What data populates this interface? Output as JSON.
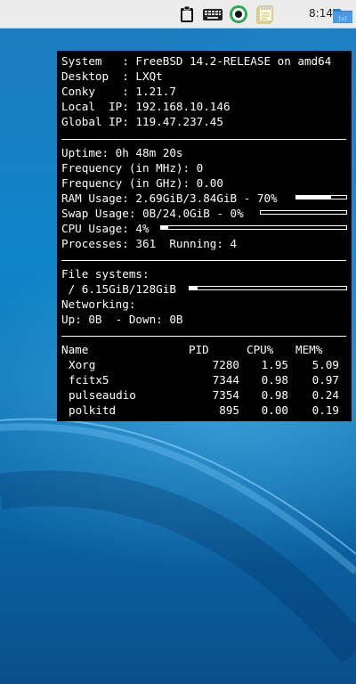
{
  "panel": {
    "clock": "8:14",
    "tray_icons": [
      "clipboard-icon",
      "keyboard-icon",
      "record-icon",
      "notes-icon",
      "file-manager-icon"
    ]
  },
  "conky": {
    "system_label": "System   : ",
    "system_value": "FreeBSD 14.2-RELEASE on amd64",
    "desktop_label": "Desktop  : ",
    "desktop_value": "LXQt",
    "conky_label": "Conky    : ",
    "conky_value": "1.21.7",
    "local_ip_label": "Local  IP: ",
    "local_ip_value": "192.168.10.146",
    "global_ip_label": "Global IP: ",
    "global_ip_value": "119.47.237.45",
    "uptime": "Uptime: 0h 48m 20s",
    "freq_mhz": "Frequency (in MHz): 0",
    "freq_ghz": "Frequency (in GHz): 0.00",
    "ram_usage": "RAM Usage: 2.69GiB/3.84GiB - 70%",
    "ram_percent": 70,
    "swap_usage": "Swap Usage: 0B/24.0GiB - 0%",
    "swap_percent": 0,
    "cpu_usage": "CPU Usage: 4%",
    "cpu_percent": 4,
    "processes": "Processes: 361  Running: 4",
    "file_systems": "File systems:",
    "fs_root": " / 6.15GiB/128GiB",
    "fs_root_percent": 5,
    "networking": "Networking:",
    "net_speeds": "Up: 0B  - Down: 0B",
    "proc_headers": {
      "name": "Name",
      "pid": "PID",
      "cpu": "CPU%",
      "mem": "MEM%"
    },
    "procs": [
      {
        "name": "Xorg",
        "pid": "7280",
        "cpu": "1.95",
        "mem": "5.09"
      },
      {
        "name": "fcitx5",
        "pid": "7344",
        "cpu": "0.98",
        "mem": "0.97"
      },
      {
        "name": "pulseaudio",
        "pid": "7354",
        "cpu": "0.98",
        "mem": "0.24"
      },
      {
        "name": "polkitd",
        "pid": "895",
        "cpu": "0.00",
        "mem": "0.19"
      }
    ]
  }
}
